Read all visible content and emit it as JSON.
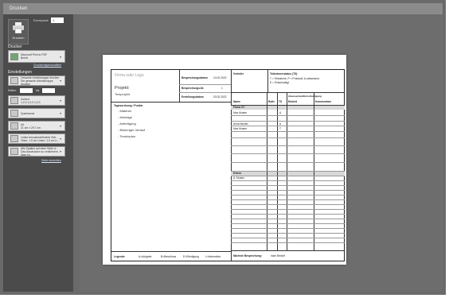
{
  "window": {
    "title": "Drucken"
  },
  "print_panel": {
    "print_button_label": "Drucken",
    "copies_label": "Exemplare",
    "copies_value": "1",
    "printer_section": "Drucker",
    "printer_name": "Microsoft Print to PDF",
    "printer_status": "Bereit",
    "printer_properties_link": "Druckereigenschaften",
    "settings_section": "Einstellungen",
    "settings": [
      {
        "line1": "Gesamte Arbeitsmappe drucken",
        "line2": "Die gesamte Arbeitsmappe drucken"
      },
      {
        "line1": "Seiten:",
        "line2": "bis"
      },
      {
        "line1": "Sortiert",
        "line2": "1;2;3   1;2;3   1;2;3"
      },
      {
        "line1": "Querformat",
        "line2": ""
      },
      {
        "line1": "A4",
        "line2": "21 cm x 29,7 cm"
      },
      {
        "line1": "Letzte benutzerdefinierte Seit...",
        "line2": "Oben: 1,9 cm Unten: 1,9 cm Li..."
      },
      {
        "line1": "Alle Spalten auf einer Seite d...",
        "line2": "Das Ausdrucken so verkleinern, dass es..."
      }
    ],
    "range_from_label": "Seiten:",
    "range_to_label": "bis",
    "page_setup_link": "Seite einrichten"
  },
  "preview": {
    "logo_placeholder": "Firma oder Logo",
    "project_label": "Projekt:",
    "project_value": "Testprojekt",
    "meeting_date_label": "Besprechungsdatum",
    "meeting_date_value": "24.02.2022",
    "meeting_no_label": "Besprechungs-Nr.",
    "meeting_no_value": "1",
    "created_label": "Erstellungsdatum",
    "created_value": "03.02.2022",
    "distribution_label": "Verteiler",
    "participants_status_label": "Teilnehmerstatus (TS)",
    "participants_legend_1": "T = Teilnahme, P = Protokoll, A=abwesend",
    "participants_legend_2": "E = Entschuldigt",
    "agenda_label": "Tagesordnung / Punkte",
    "agenda_items": [
      "- Material",
      "- Montage",
      "- Anfertigung",
      "- Bisheriger Verlauf",
      "- Terminplan"
    ],
    "table_headers": {
      "name": "Name",
      "rolle": "Rolle",
      "ts": "TS",
      "verteiler": "Abwesenheit/Entschuldigung",
      "einheit": "Einheit",
      "kommentar": "Kommentare"
    },
    "firma_label": "Firma XY",
    "firma_rows": [
      {
        "name": "Max Muster",
        "ts": "A"
      },
      {
        "name": "Anna Muster",
        "ts": "A"
      },
      {
        "name": "Max Muster",
        "ts": "T"
      }
    ],
    "extern_label": "Extern",
    "extern_rows": [
      {
        "name": "A. Muster",
        "ts": ""
      }
    ],
    "legend_title": "Legende",
    "legend_items": [
      "A=Aufgabe",
      "B=Beschluss",
      "E=Erledigung",
      "I=Information"
    ],
    "next_meeting_label": "Nächste Besprechung:",
    "next_meeting_value": "nach Bedarf"
  }
}
